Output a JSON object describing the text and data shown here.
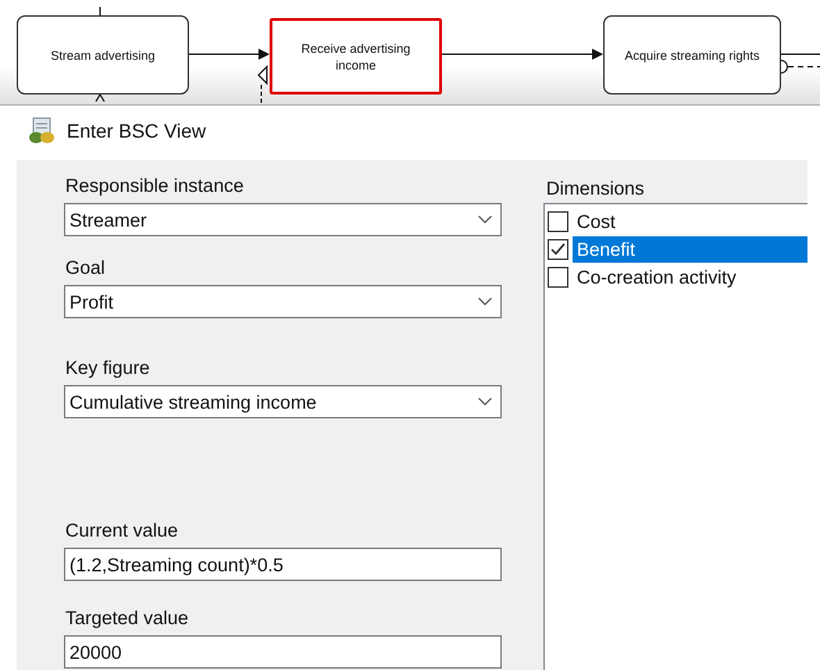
{
  "diagram": {
    "nodes": [
      {
        "label": "Stream advertising",
        "selected": false
      },
      {
        "label": "Receive advertising income",
        "selected": true
      },
      {
        "label": "Acquire streaming rights",
        "selected": false
      }
    ]
  },
  "window": {
    "title": "Enter BSC View"
  },
  "form": {
    "fields": [
      {
        "kind": "dropdown",
        "label": "Responsible instance",
        "value": "Streamer"
      },
      {
        "kind": "dropdown",
        "label": "Goal",
        "value": "Profit"
      },
      {
        "kind": "dropdown",
        "label": "Key figure",
        "value": "Cumulative streaming income"
      },
      {
        "kind": "text",
        "label": "Current value",
        "value": "(1.2,Streaming count)*0.5"
      },
      {
        "kind": "text",
        "label": "Targeted value",
        "value": "20000"
      }
    ]
  },
  "dimensions": {
    "label": "Dimensions",
    "items": [
      {
        "label": "Cost",
        "checked": false,
        "selected": false
      },
      {
        "label": "Benefit",
        "checked": true,
        "selected": true
      },
      {
        "label": "Co-creation activity",
        "checked": false,
        "selected": false
      }
    ]
  }
}
